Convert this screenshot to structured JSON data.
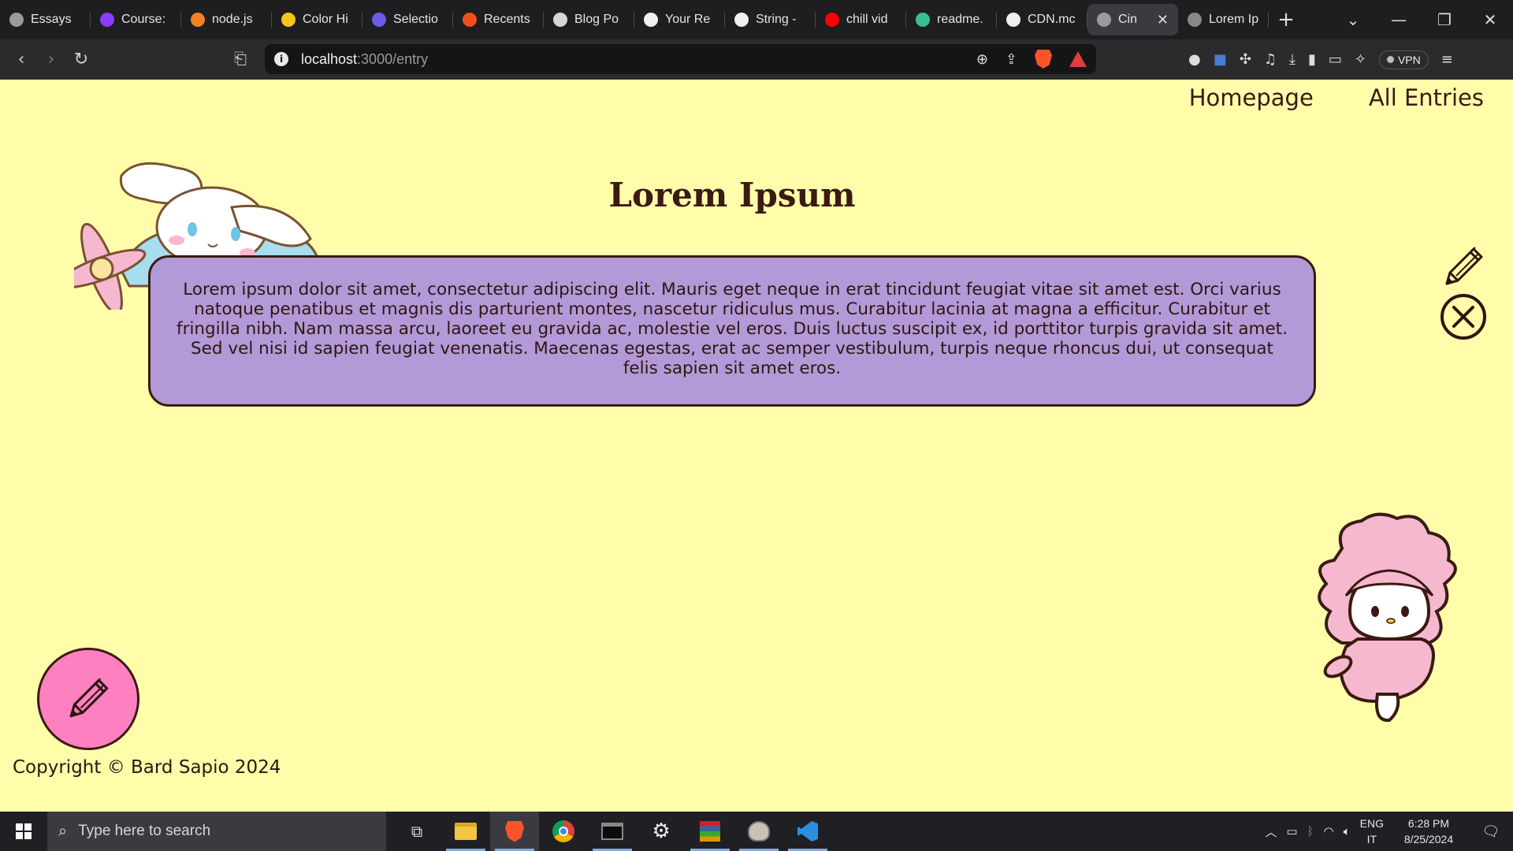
{
  "browser": {
    "tabs": [
      {
        "label": "Essays",
        "icon": "globe-icon",
        "color": "#9a9a9a"
      },
      {
        "label": "Course:",
        "icon": "udemy-icon",
        "color": "#8b3dff"
      },
      {
        "label": "node.js",
        "icon": "stackoverflow-icon",
        "color": "#f48024"
      },
      {
        "label": "Color Hi",
        "icon": "colorhunt-icon",
        "color": "#f7c61c"
      },
      {
        "label": "Selectio",
        "icon": "colorful-icon",
        "color": "#6c5ce7"
      },
      {
        "label": "Recents",
        "icon": "figma-icon",
        "color": "#f24e1e"
      },
      {
        "label": "Blog Po",
        "icon": "blog-icon",
        "color": "#d6d6d6"
      },
      {
        "label": "Your Re",
        "icon": "github-icon",
        "color": "#f0f0f0"
      },
      {
        "label": "String -",
        "icon": "mdn-icon",
        "color": "#f0f0f0"
      },
      {
        "label": "chill vid",
        "icon": "youtube-icon",
        "color": "#ff0000"
      },
      {
        "label": "readme.",
        "icon": "readme-icon",
        "color": "#3ac08e"
      },
      {
        "label": "CDN.mc",
        "icon": "github-icon",
        "color": "#f0f0f0"
      },
      {
        "label": "Cin",
        "icon": "globe-icon",
        "color": "#9a9a9a",
        "active": true
      },
      {
        "label": "Lorem Ip",
        "icon": "lorem-icon",
        "color": "#888888"
      }
    ],
    "new_tab": "+",
    "url_host": "localhost",
    "url_rest": ":3000/entry",
    "vpn_label": "VPN"
  },
  "page": {
    "nav": {
      "homepage": "Homepage",
      "all_entries": "All Entries"
    },
    "title": "Lorem Ipsum",
    "body": "Lorem ipsum dolor sit amet, consectetur adipiscing elit. Mauris eget neque in erat tincidunt feugiat vitae sit amet est. Orci varius natoque penatibus et magnis dis parturient montes, nascetur ridiculus mus. Curabitur lacinia at magna a efficitur. Curabitur et fringilla nibh. Nam massa arcu, laoreet eu gravida ac, molestie vel eros. Duis luctus suscipit ex, id porttitor turpis gravida sit amet. Sed vel nisi id sapien feugiat venenatis. Maecenas egestas, erat ac semper vestibulum, turpis neque rhoncus dui, ut consequat felis sapien sit amet eros.",
    "footer": "Copyright © Bard Sapio 2024",
    "colors": {
      "background": "#fffcaa",
      "card": "#b29ad8",
      "text": "#3a1a12",
      "fab": "#ff80c0"
    }
  },
  "taskbar": {
    "search_placeholder": "Type here to search",
    "apps": [
      "task-view-icon",
      "file-explorer-icon",
      "brave-icon",
      "chrome-icon",
      "terminal-icon",
      "settings-icon",
      "winrar-icon",
      "gimp-icon",
      "vscode-icon"
    ],
    "lang_top": "ENG",
    "lang_bottom": "IT",
    "time": "6:28 PM",
    "date": "8/25/2024"
  }
}
